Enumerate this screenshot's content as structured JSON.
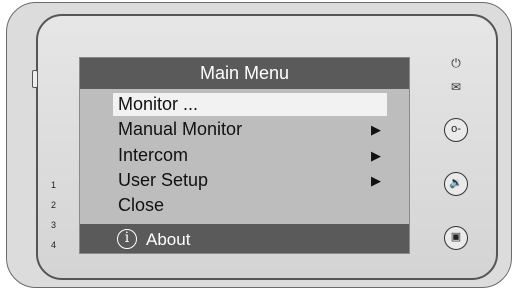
{
  "screen": {
    "title": "Main Menu",
    "items": [
      {
        "label": "Monitor ...",
        "arrow": "",
        "selected": true
      },
      {
        "label": "Manual Monitor",
        "arrow": "▶",
        "selected": false
      },
      {
        "label": "Intercom",
        "arrow": "▶",
        "selected": false
      },
      {
        "label": "User Setup",
        "arrow": "▶",
        "selected": false
      },
      {
        "label": "Close",
        "arrow": "",
        "selected": false
      }
    ],
    "about": {
      "icon": "i",
      "label": "About"
    }
  },
  "device": {
    "numbers": [
      "1",
      "2",
      "3",
      "4"
    ],
    "side_icons": {
      "power": "⏻",
      "message": "✉"
    },
    "buttons": {
      "key": "o-",
      "speaker": "🔉",
      "gate": "▣"
    }
  }
}
